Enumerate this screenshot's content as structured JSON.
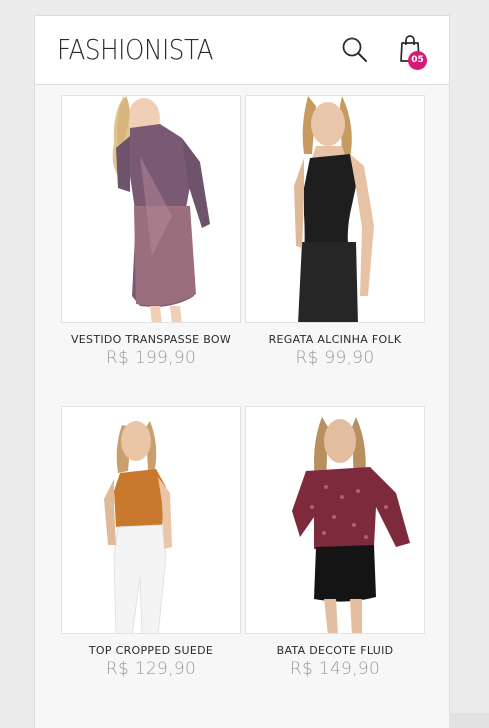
{
  "header": {
    "logo": "FASHIONISTA",
    "cart_count": "05"
  },
  "icons": {
    "search": "search-icon",
    "bag": "shopping-bag-icon"
  },
  "products": [
    {
      "name": "VESTIDO TRANSPASSE BOW",
      "price": "R$ 199,90"
    },
    {
      "name": "REGATA ALCINHA FOLK",
      "price": "R$ 99,90"
    },
    {
      "name": "TOP CROPPED SUEDE",
      "price": "R$ 129,90"
    },
    {
      "name": "BATA DECOTE FLUID",
      "price": "R$ 149,90"
    }
  ],
  "colors": {
    "badge": "#d61a7a",
    "price": "#9a9a9a"
  }
}
